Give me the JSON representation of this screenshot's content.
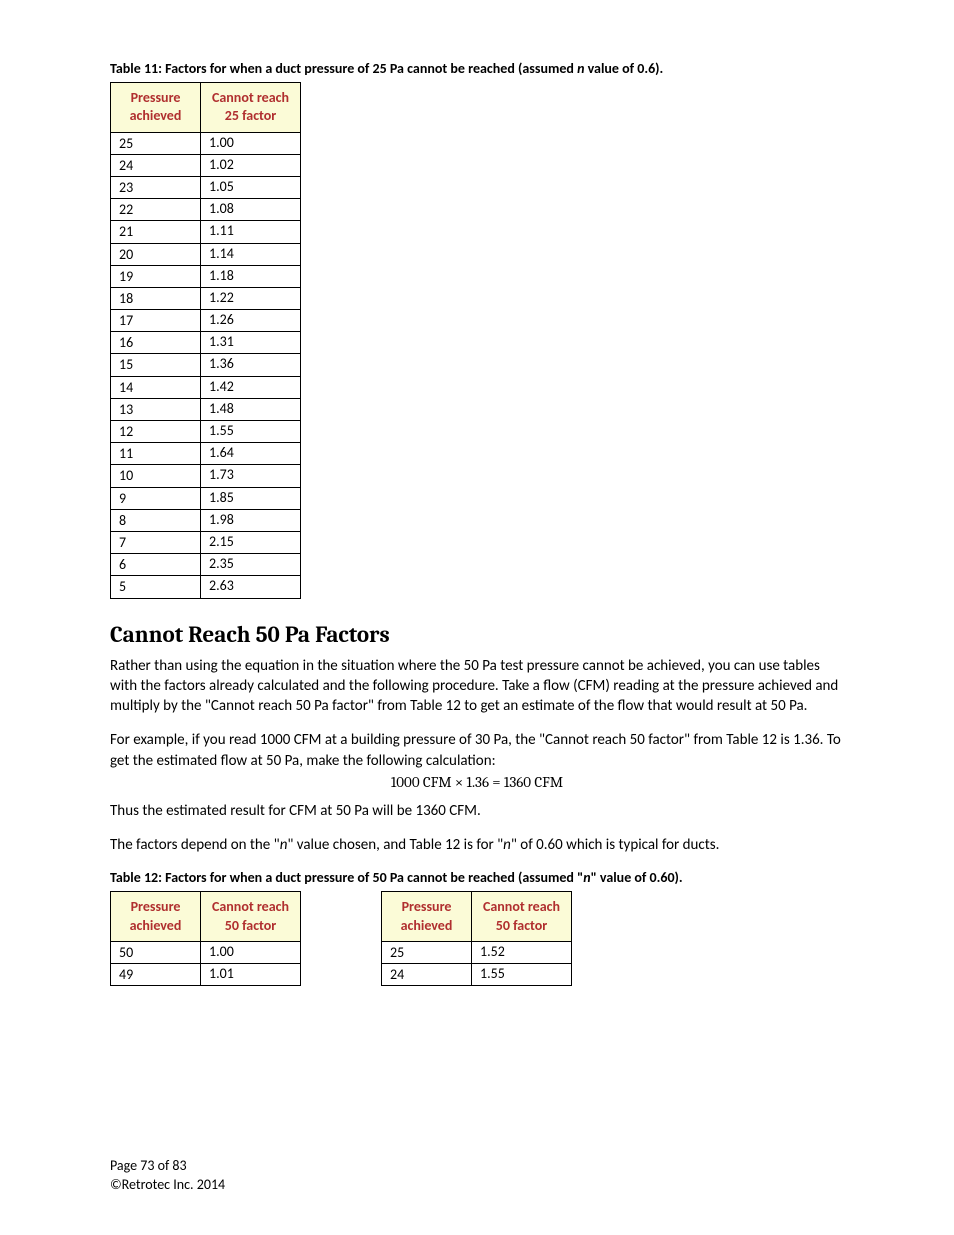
{
  "table11": {
    "caption_prefix": "Table 11:  Factors for when a duct pressure of 25 Pa cannot be reached (assumed ",
    "caption_n": "n",
    "caption_suffix": " value of 0.6).",
    "header1": "Pressure achieved",
    "header2": "Cannot reach 25 factor",
    "rows": [
      {
        "p": "25",
        "f": "1.00"
      },
      {
        "p": "24",
        "f": "1.02"
      },
      {
        "p": "23",
        "f": "1.05"
      },
      {
        "p": "22",
        "f": "1.08"
      },
      {
        "p": "21",
        "f": "1.11"
      },
      {
        "p": "20",
        "f": "1.14"
      },
      {
        "p": "19",
        "f": "1.18"
      },
      {
        "p": "18",
        "f": "1.22"
      },
      {
        "p": "17",
        "f": "1.26"
      },
      {
        "p": "16",
        "f": "1.31"
      },
      {
        "p": "15",
        "f": "1.36"
      },
      {
        "p": "14",
        "f": "1.42"
      },
      {
        "p": "13",
        "f": "1.48"
      },
      {
        "p": "12",
        "f": "1.55"
      },
      {
        "p": "11",
        "f": "1.64"
      },
      {
        "p": "10",
        "f": "1.73"
      },
      {
        "p": "9",
        "f": "1.85"
      },
      {
        "p": "8",
        "f": "1.98"
      },
      {
        "p": "7",
        "f": "2.15"
      },
      {
        "p": "6",
        "f": "2.35"
      },
      {
        "p": "5",
        "f": "2.63"
      }
    ]
  },
  "section_heading": "Cannot Reach 50 Pa Factors",
  "para1": "Rather than using the equation in the situation where the 50 Pa test pressure cannot be achieved, you can use tables with the factors already calculated and the following procedure.  Take a flow (CFM) reading at the pressure achieved and multiply by the \"Cannot reach 50 Pa factor\" from Table 12 to get an estimate of the flow that would result at 50 Pa.",
  "para2": "For example, if you read 1000 CFM at a building pressure of 30 Pa, the \"Cannot reach 50 factor\" from Table 12 is 1.36.  To get the estimated flow at 50 Pa, make the following calculation:",
  "equation": "1000 CFM  ×  1.36  =  1360 CFM",
  "para3": "Thus the estimated result for CFM at 50 Pa will be 1360 CFM.",
  "para4_a": "The factors depend on the \"",
  "para4_n1": "n",
  "para4_b": "\" value chosen, and Table 12 is for \"",
  "para4_n2": "n",
  "para4_c": "\" of 0.60 which is typical for ducts.",
  "table12": {
    "caption_prefix": "Table 12:  Factors for when a duct pressure of 50 Pa cannot be reached (assumed \"",
    "caption_n": "n",
    "caption_suffix": "\" value of 0.60).",
    "header1": "Pressure achieved",
    "header2": "Cannot reach 50 factor",
    "left_rows": [
      {
        "p": "50",
        "f": "1.00"
      },
      {
        "p": "49",
        "f": "1.01"
      }
    ],
    "right_rows": [
      {
        "p": "25",
        "f": "1.52"
      },
      {
        "p": "24",
        "f": "1.55"
      }
    ]
  },
  "footer": {
    "page": "Page 73 of 83",
    "copyright": "©Retrotec Inc. 2014"
  }
}
